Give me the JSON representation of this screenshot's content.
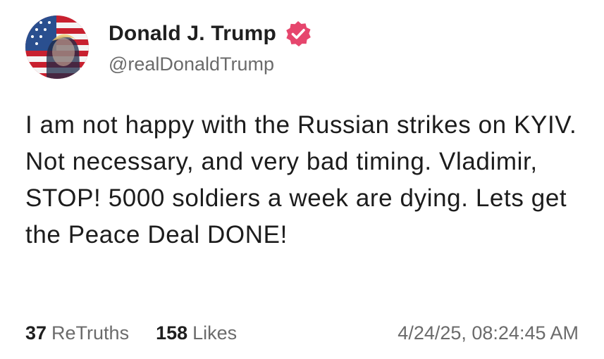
{
  "author": {
    "display_name": "Donald J. Trump",
    "handle": "@realDonaldTrump",
    "verified": true,
    "verified_color": "#e6466d",
    "avatar_icon": "flag-portrait-avatar"
  },
  "post": {
    "text": "I am not happy with the Russian strikes on KYIV. Not necessary, and very bad timing. Vladimir, STOP! 5000 soldiers a week are dying. Lets get the Peace Deal DONE!"
  },
  "stats": {
    "retruths_count": "37",
    "retruths_label": "ReTruths",
    "likes_count": "158",
    "likes_label": "Likes"
  },
  "timestamp": "4/24/25, 08:24:45 AM"
}
